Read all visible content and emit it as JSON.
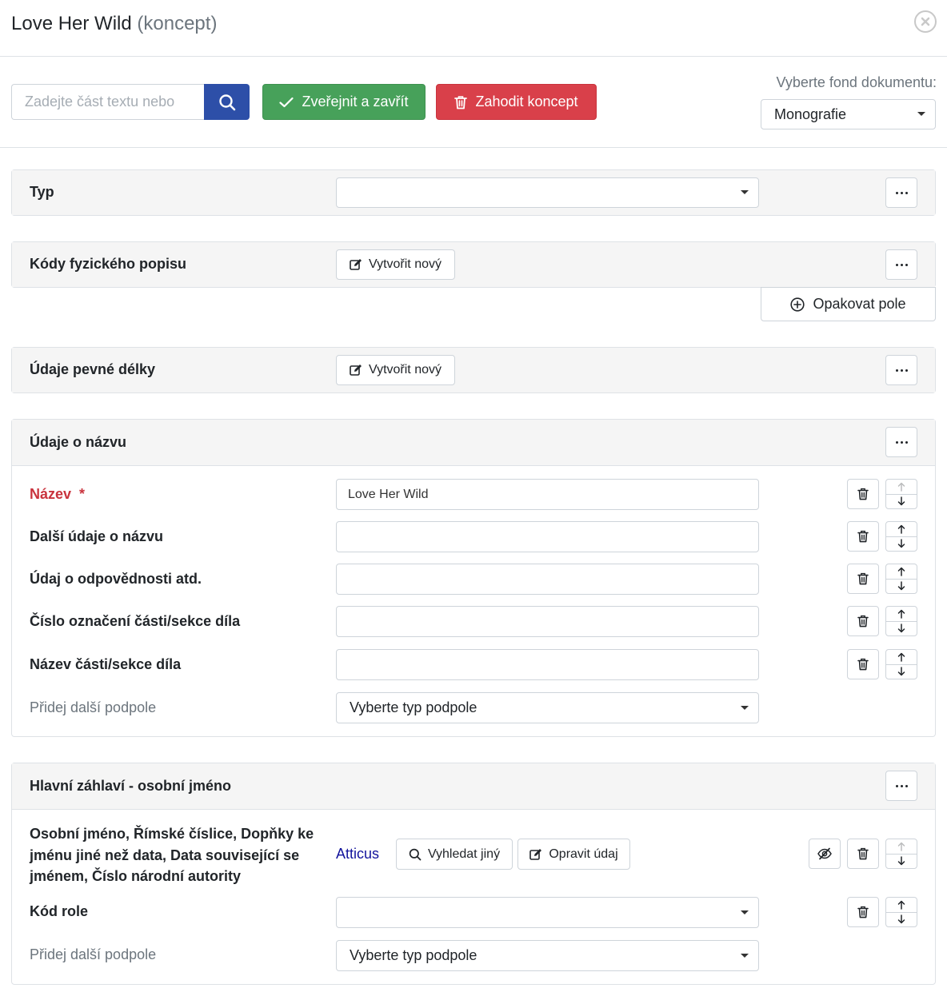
{
  "modal": {
    "title": "Love Her Wild",
    "title_suffix": "(koncept)"
  },
  "toolbar": {
    "search_placeholder": "Zadejte část textu nebo",
    "publish_label": "Zveřejnit a zavřít",
    "discard_label": "Zahodit koncept",
    "fond_label": "Vyberte fond dokumentu:",
    "fond_value": "Monografie"
  },
  "colors": {
    "primary": "#2d4fa8",
    "success": "#47a15a",
    "danger": "#d9404a",
    "required": "#c9333d",
    "link": "#12139c"
  },
  "sections": {
    "typ": {
      "title": "Typ",
      "select_value": ""
    },
    "kody": {
      "title": "Kódy fyzického popisu",
      "create_label": "Vytvořit nový",
      "repeat_label": "Opakovat pole"
    },
    "pevne": {
      "title": "Údaje pevné délky",
      "create_label": "Vytvořit nový"
    },
    "nazev": {
      "title": "Údaje o názvu",
      "fields": [
        {
          "label": "Název",
          "required_mark": "*",
          "value": "Love Her Wild"
        },
        {
          "label": "Další údaje o názvu",
          "value": ""
        },
        {
          "label": "Údaj o odpovědnosti atd.",
          "value": ""
        },
        {
          "label": "Číslo označení části/sekce díla",
          "value": ""
        },
        {
          "label": "Název části/sekce díla",
          "value": ""
        }
      ],
      "add_label": "Přidej další podpole",
      "add_select": "Vyberte typ podpole"
    },
    "osobni": {
      "title": "Hlavní záhlaví - osobní jméno",
      "field_label_lines": [
        "Osobní jméno, Římské číslice, Dopňky ke",
        "jménu jiné než data, Data související se",
        "jménem, Číslo národní autority"
      ],
      "value": "Atticus",
      "search_other_label": "Vyhledat jiný",
      "edit_label": "Opravit údaj",
      "role_label": "Kód role",
      "role_value": "",
      "add_label": "Přidej další podpole",
      "add_select": "Vyberte typ podpole"
    }
  }
}
